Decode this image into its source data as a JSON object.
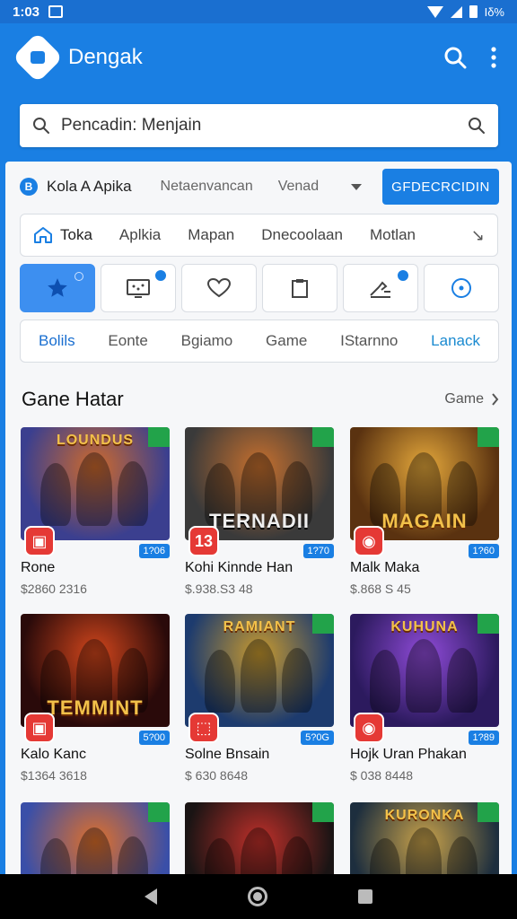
{
  "status": {
    "time": "1:03",
    "battery": "Іδ%"
  },
  "appbar": {
    "title": "Dengak",
    "logo_icon": "store-logo-icon",
    "search_icon": "search-icon",
    "more_icon": "more-vert-icon"
  },
  "search": {
    "placeholder": "Pencadin: Menjain"
  },
  "filter": {
    "badge": "B",
    "label": "Kola A Apika",
    "option1": "Netaenvancan",
    "option2": "Venad",
    "button": "GFDECRCIDIN"
  },
  "catnav": {
    "home_label": "Toka",
    "items": [
      "Aplkia",
      "Mapan",
      "Dnecoolaan",
      "Motlan"
    ],
    "arrow": "↘"
  },
  "iconrow": [
    {
      "icon": "star-icon"
    },
    {
      "icon": "tv-icon"
    },
    {
      "icon": "heart-icon"
    },
    {
      "icon": "clipboard-icon"
    },
    {
      "icon": "tools-icon"
    },
    {
      "icon": "circle-dot-icon"
    }
  ],
  "tabs": [
    "Bolils",
    "Eonte",
    "Bgiamo",
    "Game",
    "IStarnno",
    "Lanack"
  ],
  "section": {
    "title": "Gane Hatar",
    "more": "Game"
  },
  "games": [
    {
      "name": "Rone",
      "meta": "$2860 2316",
      "badge": "1?06",
      "icon_text": "▣",
      "art": "LOUNDUS",
      "c1": "#3b3f8f",
      "c2": "#ce6a2c"
    },
    {
      "name": "Kohi Kinnde Han",
      "meta": "$.938.S3 48",
      "badge": "1?70",
      "icon_text": "13",
      "art": "TERNADII",
      "c1": "#3a3a3a",
      "c2": "#c7702e"
    },
    {
      "name": "Malk Maka",
      "meta": "$.868 S 45",
      "badge": "1?60",
      "icon_text": "◉",
      "art": "MAGAIN",
      "c1": "#5a3210",
      "c2": "#e5a83b"
    },
    {
      "name": "Kalo Kanc",
      "meta": "$1364 3618",
      "badge": "5?00",
      "icon_text": "▣",
      "art": "TEMMINT",
      "c1": "#2a0a0a",
      "c2": "#d2461c"
    },
    {
      "name": "Solne Bnsain",
      "meta": "$ 630 8648",
      "badge": "5?0G",
      "icon_text": "⬚",
      "art": "RAMIANT",
      "c1": "#1d3b6e",
      "c2": "#c99a2e"
    },
    {
      "name": "Hojk Uran Phakan",
      "meta": "$ 038 8448",
      "badge": "1?89",
      "icon_text": "◉",
      "art": "KUHUNA",
      "c1": "#2c1a5e",
      "c2": "#8f4bd8"
    },
    {
      "name": "",
      "meta": "",
      "badge": "",
      "icon_text": "",
      "art": "",
      "c1": "#3a4fa8",
      "c2": "#e0702a"
    },
    {
      "name": "",
      "meta": "",
      "badge": "",
      "icon_text": "",
      "art": "",
      "c1": "#1a1414",
      "c2": "#c0302a"
    },
    {
      "name": "",
      "meta": "",
      "badge": "",
      "icon_text": "",
      "art": "KURONKA",
      "c1": "#1d2e3e",
      "c2": "#c9a24a"
    }
  ],
  "colors": {
    "primary": "#1a7fe3",
    "danger": "#e53935",
    "ribbon": "#22a34a"
  }
}
